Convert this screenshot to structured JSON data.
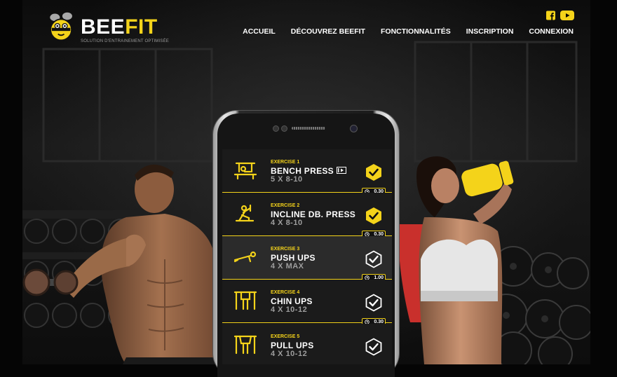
{
  "brand": {
    "name_part1": "BEE",
    "name_part2": "FIT",
    "tagline": "SOLUTION D'ENTRAINEMENT OPTIMISÉE",
    "accent_color": "#f4d31a"
  },
  "social": [
    {
      "name": "facebook-icon"
    },
    {
      "name": "youtube-icon"
    }
  ],
  "nav": {
    "items": [
      {
        "label": "ACCUEIL"
      },
      {
        "label": "DÉCOUVREZ BEEFIT"
      },
      {
        "label": "FONCTIONNALITÉS"
      },
      {
        "label": "INSCRIPTION"
      },
      {
        "label": "CONNEXION"
      }
    ]
  },
  "workout": {
    "exercises": [
      {
        "number": "EXERCISE 1",
        "name": "BENCH PRESS",
        "sets": "5 X 8-10",
        "icon": "bench-press-icon",
        "status": "completed",
        "has_video": true,
        "rest": "0.30"
      },
      {
        "number": "EXERCISE 2",
        "name": "INCLINE DB. PRESS",
        "sets": "4 X 8-10",
        "icon": "incline-press-icon",
        "status": "completed",
        "has_video": false,
        "rest": "0.30"
      },
      {
        "number": "EXERCISE 3",
        "name": "PUSH UPS",
        "sets": "4 X MAX",
        "icon": "push-up-icon",
        "status": "pending",
        "has_video": false,
        "rest": "1.00"
      },
      {
        "number": "EXERCISE 4",
        "name": "CHIN UPS",
        "sets": "4 X 10-12",
        "icon": "chin-up-icon",
        "status": "pending",
        "has_video": false,
        "rest": "0.30"
      },
      {
        "number": "EXERCISE 5",
        "name": "PULL UPS",
        "sets": "4 X 10-12",
        "icon": "pull-up-icon",
        "status": "pending",
        "has_video": false,
        "rest": ""
      }
    ]
  }
}
